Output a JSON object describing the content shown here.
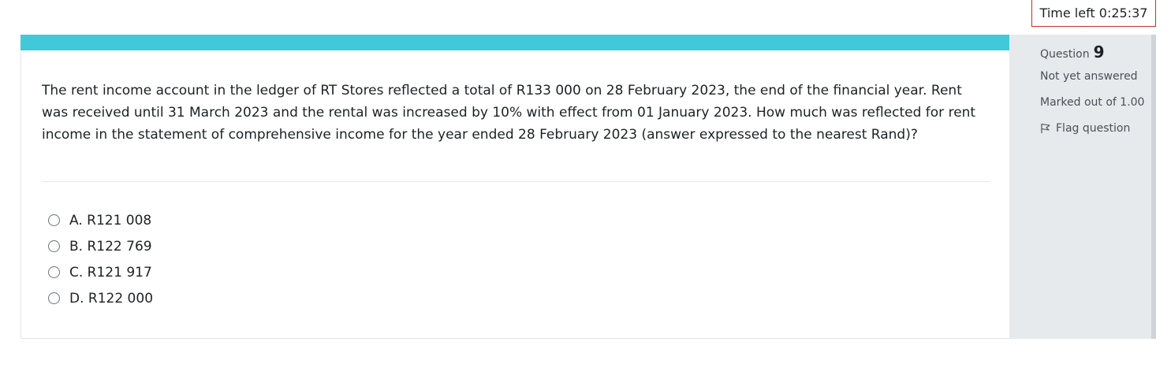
{
  "timer": {
    "text": "Time left 0:25:37"
  },
  "question": {
    "text": "The rent income account in the ledger of RT Stores reflected a total of R133 000 on 28 February 2023, the end of the financial year. Rent was received until 31 March 2023 and the rental was increased by 10% with effect from 01 January 2023. How much was reflected for rent income in the statement of comprehensive income for the year ended 28 February 2023 (answer expressed to the nearest Rand)?",
    "answers": [
      {
        "label": "A. R121 008"
      },
      {
        "label": "B. R122 769"
      },
      {
        "label": "C. R121 917"
      },
      {
        "label": "D. R122 000"
      }
    ]
  },
  "info": {
    "question_label": "Question",
    "question_number": "9",
    "status": "Not yet answered",
    "grade": "Marked out of 1.00",
    "flag_label": "Flag question"
  },
  "colors": {
    "accent_bar": "#41c9d9",
    "timer_border": "#ca3120",
    "info_panel": "#e7eaed"
  }
}
